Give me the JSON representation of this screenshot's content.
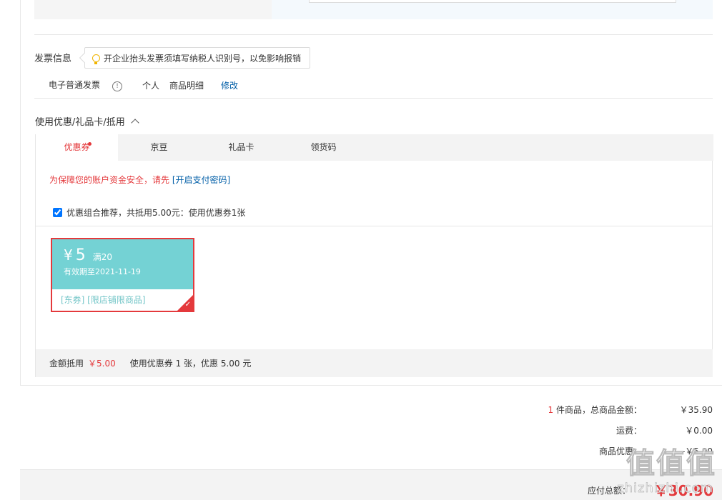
{
  "invoice": {
    "section_title": "发票信息",
    "tip": "开企业抬头发票须填写纳税人识别号，以免影响报销",
    "type": "电子普通发票",
    "info_glyph": "!",
    "title_type": "个人",
    "content": "商品明细",
    "edit_label": "修改"
  },
  "discount": {
    "section_title": "使用优惠/礼品卡/抵用",
    "toggle_glyph": "^",
    "tabs": [
      {
        "label": "优惠券"
      },
      {
        "label": "京豆"
      },
      {
        "label": "礼品卡"
      },
      {
        "label": "领货码"
      }
    ],
    "warning_text": "为保障您的账户资金安全，请先",
    "warning_link": "[开启支付密码]",
    "combo_label": "优惠组合推荐，共抵用5.00元：使用优惠券1张",
    "coupon": {
      "currency": "¥",
      "amount": "5",
      "condition": "满20",
      "validity": "有效期至2021-11-19",
      "tags": "[东券] [限店铺限商品]",
      "check_glyph": "✓"
    },
    "summary": {
      "label": "金额抵用",
      "amount": "￥5.00",
      "detail": "使用优惠券 1 张，优惠 5.00 元"
    }
  },
  "totals": {
    "count": "1",
    "items_label": "件商品，总商品金额：",
    "items_value": "￥35.90",
    "shipping_label": "运费：",
    "shipping_value": "￥0.00",
    "discount_label": "商品优惠：",
    "discount_value": "-￥5.00",
    "payable_label": "应付总额：",
    "payable_value": "￥30.90"
  },
  "watermark": {
    "main": "值值值",
    "sub": "zhizhizhi.com"
  },
  "colors": {
    "accent": "#e4393c",
    "link": "#005ea7",
    "coupon": "#74d2d4"
  }
}
